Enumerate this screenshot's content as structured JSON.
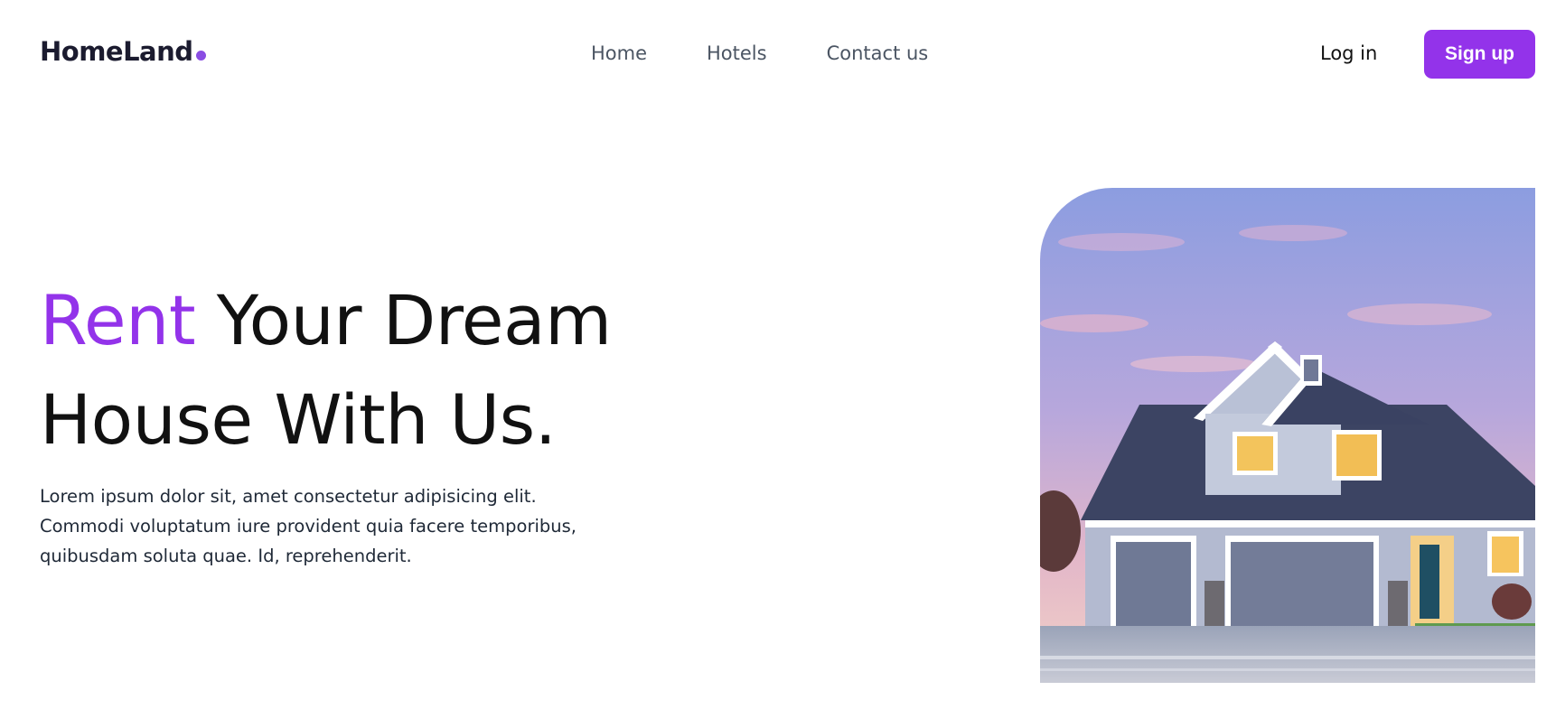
{
  "brand": {
    "name": "HomeLand",
    "dot_color": "#8a4de3"
  },
  "nav": {
    "links": [
      "Home",
      "Hotels",
      "Contact us"
    ],
    "login_label": "Log in",
    "signup_label": "Sign up"
  },
  "hero": {
    "title_accent": "Rent",
    "title_rest_line1": "Your Dream",
    "title_line2": "House With Us.",
    "description": "Lorem ipsum dolor sit, amet consectetur adipisicing elit. Commodi voluptatum iure provident quia facere temporibus, quibusdam soluta quae. Id, reprehenderit."
  },
  "colors": {
    "accent": "#9333ea",
    "text_dark": "#111111",
    "nav_text": "#4b5563"
  }
}
